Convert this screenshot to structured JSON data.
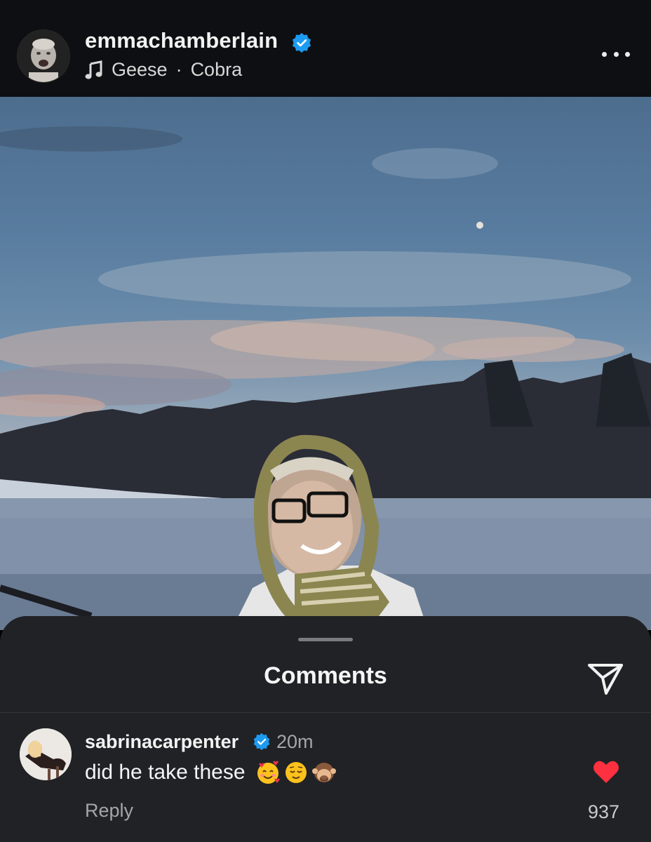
{
  "post": {
    "username": "emmachamberlain",
    "verified": true,
    "music": {
      "artist": "Geese",
      "separator": "·",
      "song": "Cobra"
    },
    "more_icon": "more-horizontal-icon"
  },
  "comments_sheet": {
    "title": "Comments",
    "share_icon": "paper-plane-icon",
    "comments": [
      {
        "username": "sabrinacarpenter",
        "verified": true,
        "time": "20m",
        "text": "did he take these",
        "emojis": [
          "smiling-face-with-hearts",
          "relieved-face",
          "see-no-evil-monkey"
        ],
        "reply_label": "Reply",
        "like_count": "937",
        "liked": true
      }
    ]
  },
  "colors": {
    "verified_blue": "#1d9bf0",
    "like_red": "#ff3040",
    "sheet_bg": "#212226",
    "header_bg": "#0e0f12"
  }
}
